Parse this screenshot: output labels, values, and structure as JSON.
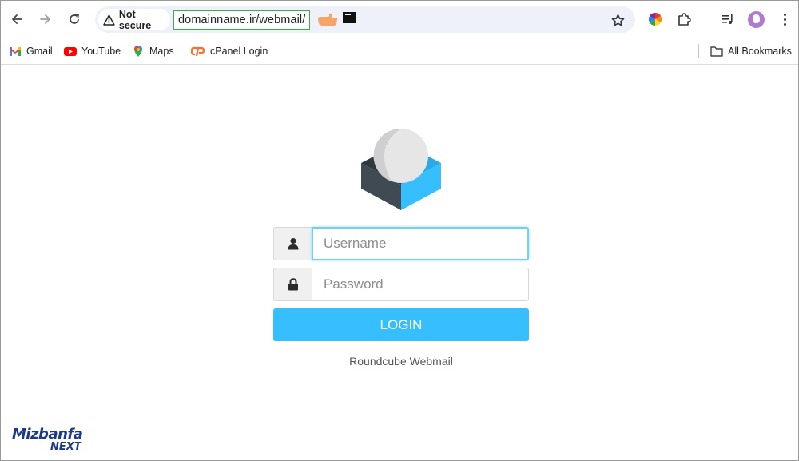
{
  "browser": {
    "security_label": "Not secure",
    "url": "domainname.ir/webmail/"
  },
  "bookmarks": [
    {
      "label": "Gmail",
      "icon": "gmail-icon"
    },
    {
      "label": "YouTube",
      "icon": "youtube-icon"
    },
    {
      "label": "Maps",
      "icon": "maps-icon"
    },
    {
      "label": "cPanel Login",
      "icon": "cpanel-icon"
    }
  ],
  "all_bookmarks_label": "All Bookmarks",
  "login": {
    "username_placeholder": "Username",
    "password_placeholder": "Password",
    "button_label": "LOGIN",
    "product_name": "Roundcube Webmail"
  },
  "watermark": {
    "line1": "Mizbanfa",
    "line2": "NEXT"
  },
  "colors": {
    "accent": "#37beff",
    "logo_dark": "#3f4a52",
    "logo_light": "#37beff",
    "logo_ball": "#e0e0e0"
  }
}
